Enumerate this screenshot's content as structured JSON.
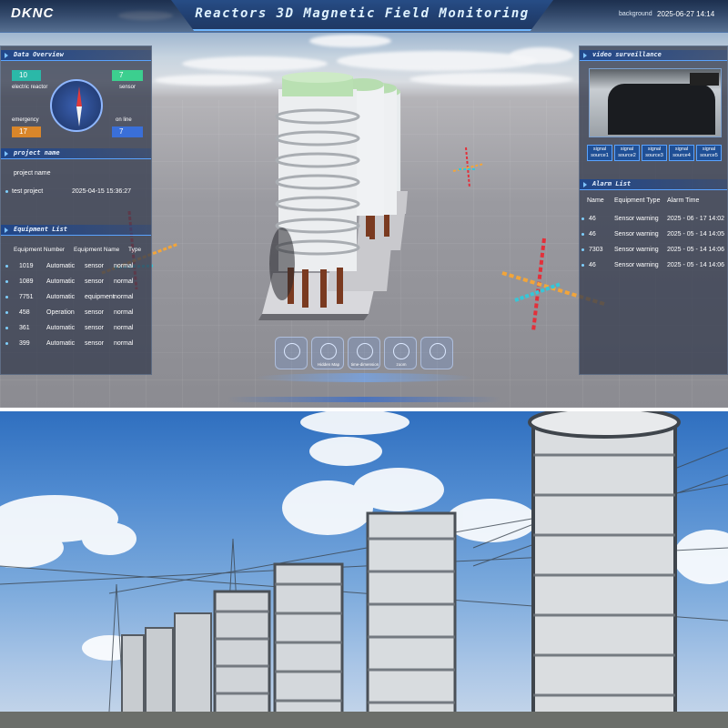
{
  "header": {
    "logo": "DKNC",
    "title": "Reactors 3D Magnetic Field Monitoring",
    "background_label": "background",
    "datetime": "2025-06-27 14:14"
  },
  "data_overview": {
    "title": "Data Overview",
    "electric_reactor": {
      "label": "electric reactor",
      "value": "10"
    },
    "sensor": {
      "label": "sensor",
      "value": "7"
    },
    "emergency": {
      "label": "emergency",
      "value": "17"
    },
    "online": {
      "label": "on line",
      "value": "7"
    }
  },
  "project": {
    "title": "project name",
    "header": "project name",
    "name": "test project",
    "time": "2025-04-15 15:36:27"
  },
  "equipment": {
    "title": "Equipment List",
    "columns": [
      "Equipment Number",
      "Equipment Name",
      "Type"
    ],
    "rows": [
      [
        "1019",
        "Automatic",
        "sensor",
        "normal"
      ],
      [
        "1089",
        "Automatic",
        "sensor",
        "normal"
      ],
      [
        "7751",
        "Automatic",
        "equipment",
        "normal"
      ],
      [
        "458",
        "Operation",
        "sensor",
        "normal"
      ],
      [
        "361",
        "Automatic",
        "sensor",
        "normal"
      ],
      [
        "399",
        "Automatic",
        "sensor",
        "normal"
      ]
    ]
  },
  "video": {
    "title": "video surveillance",
    "sources": [
      "signal source1",
      "signal source2",
      "signal source3",
      "signal source4",
      "signal source5"
    ]
  },
  "alarm": {
    "title": "Alarm List",
    "columns": [
      "Name",
      "Equipment Type",
      "Alarm Time"
    ],
    "rows": [
      [
        "46",
        "Sensor warning",
        "2025 - 06 - 17 14:02"
      ],
      [
        "46",
        "Sensor warning",
        "2025 - 05 - 14 14:05"
      ],
      [
        "7303",
        "Sensor warning",
        "2025 - 05 - 14 14:06"
      ],
      [
        "46",
        "Sensor warning",
        "2025 - 05 - 14 14:06"
      ]
    ]
  },
  "toolbar": {
    "items": [
      "",
      "Hidden Map",
      "time-dimension",
      "zoom",
      ""
    ]
  },
  "colors": {
    "accent": "#5aa3ff",
    "electric_reactor": "#2bb8a8",
    "sensor": "#3ccf8f",
    "emergency": "#d9862a",
    "online": "#3a6fd8"
  }
}
